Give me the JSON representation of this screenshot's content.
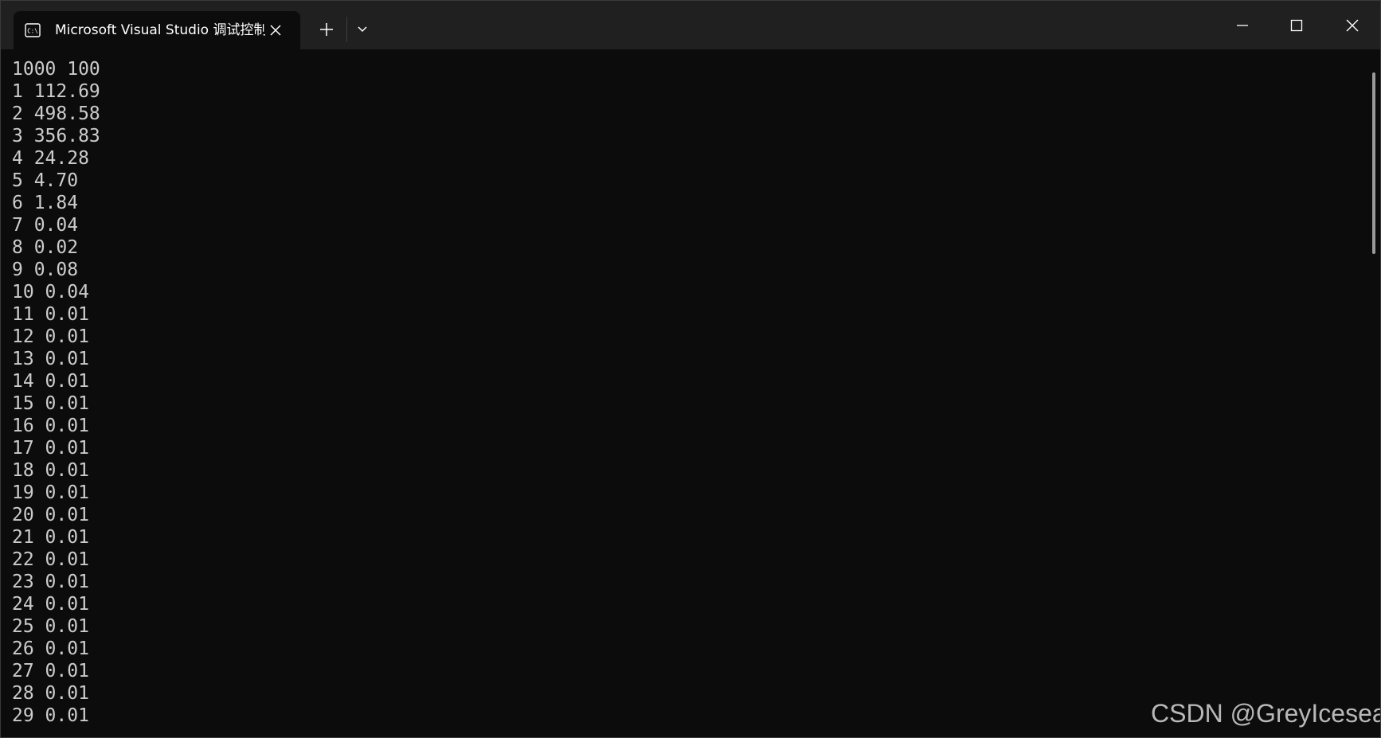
{
  "window": {
    "tab_title": "Microsoft Visual Studio 调试控制台",
    "tab_icon": "console-icon",
    "close_tab_icon": "close-icon",
    "new_tab_icon": "plus-icon",
    "dropdown_icon": "chevron-down-icon",
    "controls": [
      "minimize-icon",
      "maximize-icon",
      "close-icon"
    ]
  },
  "terminal": {
    "lines": [
      "1000 100",
      "1 112.69",
      "2 498.58",
      "3 356.83",
      "4 24.28",
      "5 4.70",
      "6 1.84",
      "7 0.04",
      "8 0.02",
      "9 0.08",
      "10 0.04",
      "11 0.01",
      "12 0.01",
      "13 0.01",
      "14 0.01",
      "15 0.01",
      "16 0.01",
      "17 0.01",
      "18 0.01",
      "19 0.01",
      "20 0.01",
      "21 0.01",
      "22 0.01",
      "23 0.01",
      "24 0.01",
      "25 0.01",
      "26 0.01",
      "27 0.01",
      "28 0.01",
      "29 0.01"
    ]
  },
  "watermark": "CSDN @GreyIcesea",
  "colors": {
    "titlebar": "#202020",
    "background": "#0c0c0c",
    "text": "#cccccc"
  }
}
